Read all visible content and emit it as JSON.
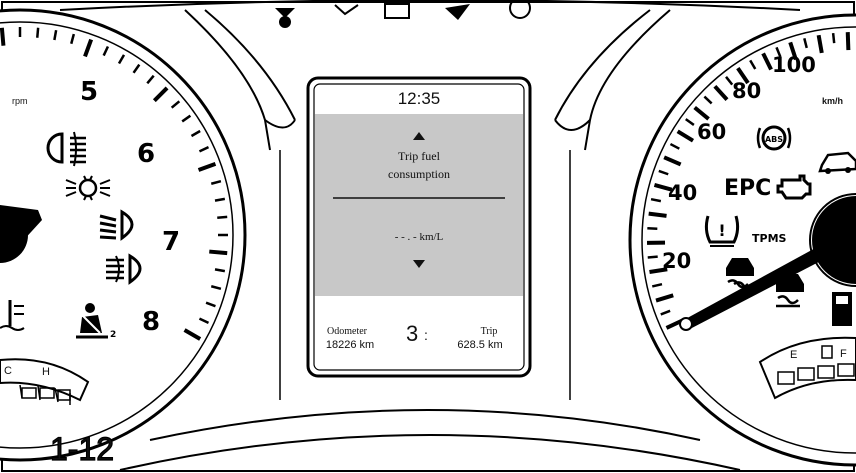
{
  "tachometer": {
    "unit": "rpm",
    "numbers": [
      "5",
      "6",
      "7",
      "8"
    ],
    "temp_gauge": {
      "low": "C",
      "high": "H"
    }
  },
  "speedometer": {
    "unit": "km/h",
    "numbers": [
      "20",
      "40",
      "60",
      "80",
      "100"
    ],
    "fuel_gauge": {
      "empty": "E",
      "full": "F"
    },
    "warning_labels": {
      "epc": "EPC",
      "tpms": "TPMS",
      "abs": "ABS"
    }
  },
  "display": {
    "clock": "12:35",
    "menu_title_line1": "Trip fuel",
    "menu_title_line2": "consumption",
    "value": "- - . - km/L",
    "odometer_label": "Odometer",
    "odometer_value": "18226 km",
    "gear": "3",
    "trip_label": "Trip",
    "trip_value": "628.5 km"
  },
  "figure_ref": "1-12",
  "icons": [
    "fog-light-rear-icon",
    "side-light-icon",
    "low-beam-icon",
    "fog-light-front-icon",
    "seatbelt-icon",
    "coolant-temp-icon",
    "abs-icon",
    "engine-icon",
    "tpms-icon",
    "esc-icon",
    "esc-off-icon",
    "door-open-icon",
    "fuel-pump-icon"
  ]
}
